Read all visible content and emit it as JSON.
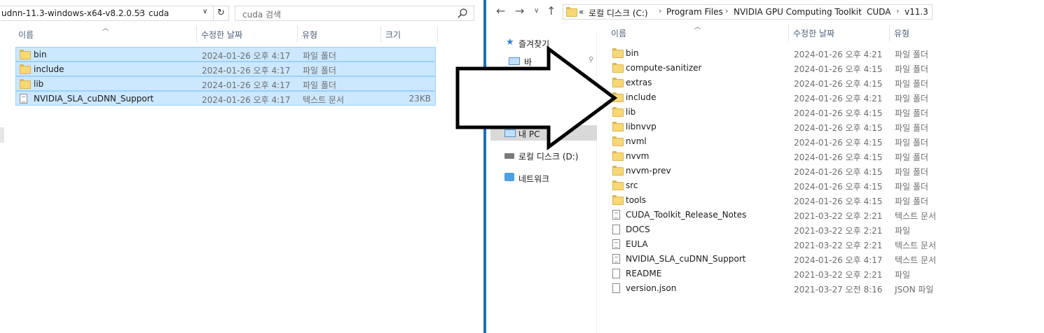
{
  "left": {
    "address": [
      "udnn-11.3-windows-x64-v8.2.0.53",
      "cuda"
    ],
    "search_placeholder": "cuda 검색",
    "columns": {
      "name": "이름",
      "date": "수정한 날짜",
      "type": "유형",
      "size": "크기"
    },
    "rows": [
      {
        "name": "bin",
        "date": "2024-01-26 오후 4:17",
        "type": "파일 폴더",
        "size": "",
        "icon": "folder-icon",
        "selected": true
      },
      {
        "name": "include",
        "date": "2024-01-26 오후 4:17",
        "type": "파일 폴더",
        "size": "",
        "icon": "folder-icon",
        "selected": true
      },
      {
        "name": "lib",
        "date": "2024-01-26 오후 4:17",
        "type": "파일 폴더",
        "size": "",
        "icon": "folder-icon",
        "selected": true
      },
      {
        "name": "NVIDIA_SLA_cuDNN_Support",
        "date": "2024-01-26 오후 4:17",
        "type": "텍스트 문서",
        "size": "23KB",
        "icon": "text-file-icon",
        "selected": true
      }
    ]
  },
  "right": {
    "address": [
      "로컬 디스크 (C:)",
      "Program Files",
      "NVIDIA GPU Computing Toolkit",
      "CUDA",
      "v11.3"
    ],
    "address_overflow": "«",
    "columns": {
      "name": "이름",
      "date": "수정한 날짜",
      "type": "유형"
    },
    "nav": [
      {
        "label": "즐겨찾기",
        "icon": "star-icon",
        "pinned": false
      },
      {
        "label": "바",
        "icon": "desktop-icon",
        "pinned": true
      },
      {
        "label": "내 PC",
        "icon": "pc-icon",
        "pinned": false,
        "selected": true
      },
      {
        "label": "로컬 디스크 (D:)",
        "icon": "drive-icon",
        "pinned": false
      },
      {
        "label": "네트워크",
        "icon": "network-icon",
        "pinned": false
      }
    ],
    "rows": [
      {
        "name": "bin",
        "date": "2024-01-26 오후 4:21",
        "type": "파일 폴더",
        "icon": "folder-icon"
      },
      {
        "name": "compute-sanitizer",
        "date": "2024-01-26 오후 4:15",
        "type": "파일 폴더",
        "icon": "folder-icon"
      },
      {
        "name": "extras",
        "date": "2024-01-26 오후 4:15",
        "type": "파일 폴더",
        "icon": "folder-icon"
      },
      {
        "name": "include",
        "date": "2024-01-26 오후 4:21",
        "type": "파일 폴더",
        "icon": "folder-icon"
      },
      {
        "name": "lib",
        "date": "2024-01-26 오후 4:15",
        "type": "파일 폴더",
        "icon": "folder-icon"
      },
      {
        "name": "libnvvp",
        "date": "2024-01-26 오후 4:15",
        "type": "파일 폴더",
        "icon": "folder-icon"
      },
      {
        "name": "nvml",
        "date": "2024-01-26 오후 4:15",
        "type": "파일 폴더",
        "icon": "folder-icon"
      },
      {
        "name": "nvvm",
        "date": "2024-01-26 오후 4:15",
        "type": "파일 폴더",
        "icon": "folder-icon"
      },
      {
        "name": "nvvm-prev",
        "date": "2024-01-26 오후 4:15",
        "type": "파일 폴더",
        "icon": "folder-icon"
      },
      {
        "name": "src",
        "date": "2024-01-26 오후 4:15",
        "type": "파일 폴더",
        "icon": "folder-icon"
      },
      {
        "name": "tools",
        "date": "2024-01-26 오후 4:15",
        "type": "파일 폴더",
        "icon": "folder-icon"
      },
      {
        "name": "CUDA_Toolkit_Release_Notes",
        "date": "2021-03-22 오후 2:21",
        "type": "텍스트 문서",
        "icon": "text-file-icon"
      },
      {
        "name": "DOCS",
        "date": "2021-03-22 오후 2:21",
        "type": "파일",
        "icon": "file-icon"
      },
      {
        "name": "EULA",
        "date": "2021-03-22 오후 2:21",
        "type": "텍스트 문서",
        "icon": "text-file-icon"
      },
      {
        "name": "NVIDIA_SLA_cuDNN_Support",
        "date": "2024-01-26 오후 4:17",
        "type": "텍스트 문서",
        "icon": "text-file-icon"
      },
      {
        "name": "README",
        "date": "2021-03-22 오후 2:21",
        "type": "파일",
        "icon": "file-icon"
      },
      {
        "name": "version.json",
        "date": "2021-03-27 오전 8:16",
        "type": "JSON 파일",
        "icon": "file-icon"
      }
    ]
  },
  "colors": {
    "selection": "#cce8ff",
    "selection_border": "#99d1ff",
    "divider": "#1f6fb5",
    "header_text": "#4c607a",
    "muted_text": "#6d6d6d"
  }
}
